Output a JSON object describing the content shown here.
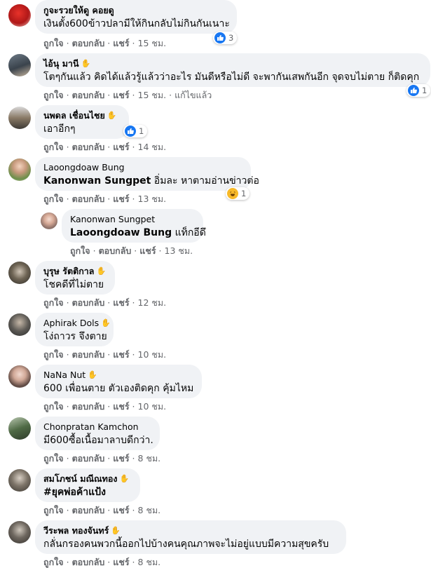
{
  "labels": {
    "like": "ถูกใจ",
    "reply": "ตอบกลับ",
    "share": "แชร์",
    "edited": "แก้ไขแล้ว"
  },
  "comments": [
    {
      "author": "กูจะรวยให้ดู คอยดู",
      "text": "เงินตั้ง600ข้าวปลามีให้กินกลับไม่กินกันเนาะ",
      "time": "15 ชม.",
      "reactions": "3"
    },
    {
      "author": "ไอ้นุ มานี",
      "text": "โตๆกันแล้ว คิดได้แล้วรู้แล้วว่าอะไร มันดีหรือไม่ดี จะพากันเสพกันอีก จุดจบไม่ตาย ก็ติดคุก",
      "time": "15 ชม.",
      "reactions": "1"
    },
    {
      "author": "นพดล เชื่อนไชย",
      "text": "เอาอีกๆ",
      "time": "14 ชม.",
      "reactions": "1"
    },
    {
      "author": "Laoongdoaw Bung",
      "tag": "Kanonwan Sungpet",
      "text": "อิ่มละ หาตามอ่านข่าวต่อ",
      "time": "13 ชม.",
      "reactions": "1"
    },
    {
      "author": "Kanonwan Sungpet",
      "tag": "Laoongdoaw Bung",
      "text": "แท็กอีดึ",
      "time": "13 ชม."
    },
    {
      "author": "บุรุษ รัตติกาล",
      "text": "โชคดีที่ไม่ตาย",
      "time": "12 ชม."
    },
    {
      "author": "Aphirak Dols",
      "text": "โง่ถาวร จึงตาย",
      "time": "10 ชม."
    },
    {
      "author": "NaNa Nut",
      "text": "600 เพื่อนตาย ตัวเองติดคุก คุ้มไหม",
      "time": "10 ชม."
    },
    {
      "author": "Chonpratan Kamchon",
      "text": "มี600ซื้อเนื้อมาลาบดีกว่า.",
      "time": "8 ชม."
    },
    {
      "author": "สมโภชน์ มณีณทอง",
      "text": "#ยุคพ่อค้าแป้ง",
      "time": "8 ชม."
    },
    {
      "author": "วีระพล ทองจันทร์",
      "text": "กลั่นกรองคนพวกนี้ออกไปบ้างคนคุณภาพจะไม่อยู่แบบมีความสุขครับ",
      "time": "8 ชม."
    }
  ],
  "colors": {
    "bubble": "#f0f2f5",
    "meta": "#65676b",
    "like": "#1877f2",
    "haha": "#f7b928"
  }
}
